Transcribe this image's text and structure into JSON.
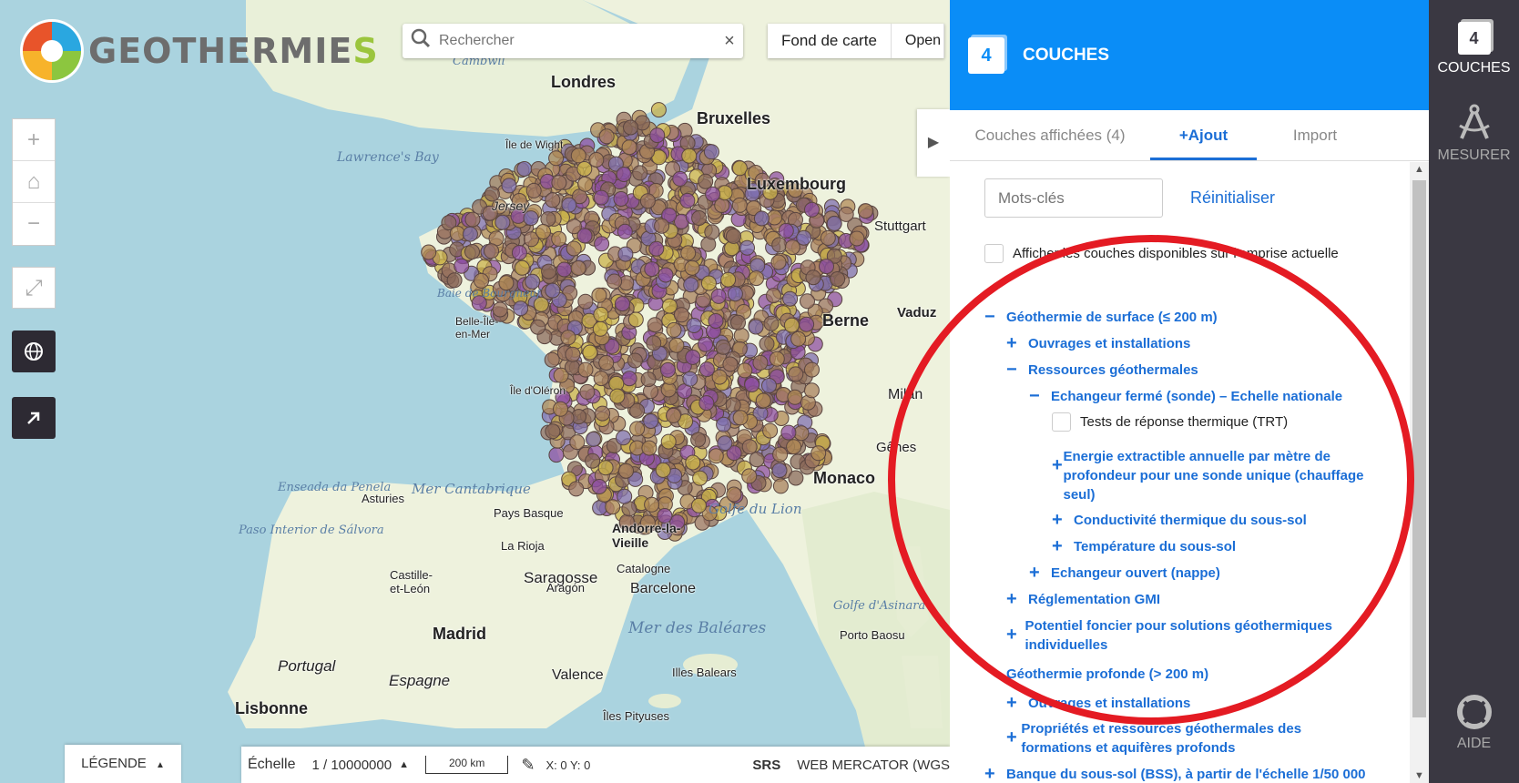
{
  "app": {
    "logo_text_main": "GEOTHERMIE",
    "logo_text_accent": "S"
  },
  "search": {
    "placeholder": "Rechercher",
    "clear_icon": "×"
  },
  "basemap_bar": {
    "fond_label": "Fond de carte",
    "open_label": "Open"
  },
  "map_controls": {
    "zoom_in": "+",
    "home": "⌂",
    "zoom_out": "−",
    "fullscreen": "⤢",
    "globe": "◍",
    "share": "⬈",
    "collapse": "▶"
  },
  "map_labels": {
    "water": [
      "Mer Cantabrique",
      "Golfe du Lion",
      "Mer des Baléares",
      "Golfe d'Asinara",
      "Enseada da Penela",
      "Paso Interior de Sálvora",
      "Lawrence's Bay",
      "Baie de Bourgneuf",
      "Cambwll"
    ],
    "cities": [
      {
        "name": "Londres"
      },
      {
        "name": "Bruxelles"
      },
      {
        "name": "Luxembourg"
      },
      {
        "name": "Stuttgart"
      },
      {
        "name": "Berne"
      },
      {
        "name": "Vaduz"
      },
      {
        "name": "Milan"
      },
      {
        "name": "Gênes"
      },
      {
        "name": "Monaco"
      },
      {
        "name": "Andorre-la-Vieille"
      },
      {
        "name": "Saragosse"
      },
      {
        "name": "Barcelone"
      },
      {
        "name": "Madrid"
      },
      {
        "name": "Valence"
      },
      {
        "name": "Lisbonne"
      },
      {
        "name": "Portugal"
      },
      {
        "name": "Espagne"
      },
      {
        "name": "Île de Wight"
      },
      {
        "name": "Jersey"
      },
      {
        "name": "Belle-Île-en-Mer"
      },
      {
        "name": "Île d'Oléron"
      },
      {
        "name": "Pays Basque"
      },
      {
        "name": "La Rioja"
      },
      {
        "name": "Asturies"
      },
      {
        "name": "Castille-et-León"
      },
      {
        "name": "Illes Balears"
      },
      {
        "name": "Îles Pityuses"
      },
      {
        "name": "Catalogne"
      },
      {
        "name": "Aragón"
      },
      {
        "name": "Porto Baosu"
      }
    ]
  },
  "bottom": {
    "legend_label": "LÉGENDE",
    "legend_caret": "▲",
    "scale_label": "Échelle",
    "scale_value": "1 / 10000000",
    "scale_up": "▲",
    "ruler": "200 km",
    "pencil_icon": "✎",
    "coords": "X: 0 Y: 0",
    "srs_label": "SRS",
    "srs_value": "WEB MERCATOR (WGS"
  },
  "panel": {
    "count": "4",
    "title": "COUCHES",
    "tabs": [
      "Couches affichées (4)",
      "+Ajout",
      "Import"
    ],
    "keyword_placeholder": "Mots-clés",
    "reset_label": "Réinitialiser",
    "extent_label": "Afficher les couches disponibles sur l'emprise actuelle",
    "tree": [
      {
        "sign": "−",
        "label": "Géothermie de surface (≤ 200 m)"
      },
      {
        "sign": "+",
        "label": "Ouvrages et installations"
      },
      {
        "sign": "−",
        "label": "Ressources géothermales"
      },
      {
        "sign": "−",
        "label": "Echangeur fermé (sonde) – Echelle nationale"
      },
      {
        "sign": "",
        "label": "Tests de réponse thermique (TRT)"
      },
      {
        "sign": "+",
        "label": "Energie extractible annuelle par mètre de profondeur pour une sonde unique (chauffage seul)"
      },
      {
        "sign": "+",
        "label": "Conductivité thermique du sous-sol"
      },
      {
        "sign": "+",
        "label": "Température du sous-sol"
      },
      {
        "sign": "+",
        "label": "Echangeur ouvert (nappe)"
      },
      {
        "sign": "+",
        "label": "Réglementation GMI"
      },
      {
        "sign": "+",
        "label": "Potentiel foncier pour solutions géothermiques individuelles"
      },
      {
        "sign": "",
        "label": "Géothermie profonde (> 200 m)"
      },
      {
        "sign": "+",
        "label": "Ouvrages et installations"
      },
      {
        "sign": "+",
        "label": "Propriétés et ressources géothermales des formations et aquifères profonds"
      },
      {
        "sign": "+",
        "label": "Banque du sous-sol (BSS), à partir de l'échelle 1/50 000"
      }
    ]
  },
  "toolbar": {
    "couches_count": "4",
    "couches_label": "COUCHES",
    "mesurer_label": "MESURER",
    "aide_label": "AIDE"
  },
  "colors": {
    "panel_header": "#0a8df7",
    "link": "#1b6ed6",
    "toolbar": "#3a3842",
    "annotation": "#e41b23"
  }
}
